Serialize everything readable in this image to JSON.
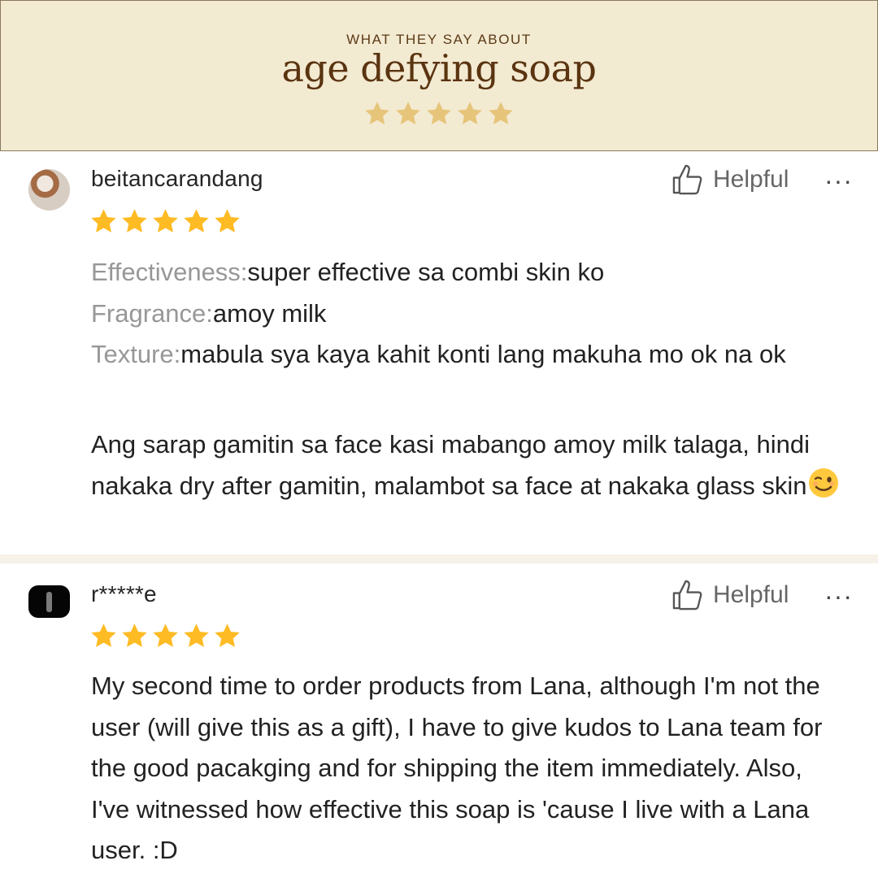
{
  "header": {
    "kicker": "WHAT THEY SAY ABOUT",
    "title": "age defying soap",
    "rating": 5,
    "star_color": "#e6c57a",
    "background": "#f3ead2"
  },
  "reviews": [
    {
      "username": "beitancarandang",
      "avatar_icon": "avatar-photo",
      "helpful_label": "Helpful",
      "more_label": "···",
      "rating": 5,
      "attributes": [
        {
          "label": "Effectiveness:",
          "value": "super effective sa combi skin ko"
        },
        {
          "label": "Fragrance:",
          "value": "amoy milk"
        },
        {
          "label": "Texture:",
          "value": "mabula sya kaya kahit konti lang makuha mo ok na ok"
        }
      ],
      "comment": "Ang sarap gamitin sa face kasi mabango amoy milk talaga, hindi nakaka dry after gamitin, malambot sa face at nakaka glass skin",
      "emoji": "winking-face-emoji"
    },
    {
      "username": "r*****e",
      "avatar_icon": "avatar-photo",
      "helpful_label": "Helpful",
      "more_label": "···",
      "rating": 5,
      "comment": "My second time to order products from Lana, although I'm not the user (will give this as a gift), I have to give kudos to Lana team for the good pacakging and for shipping the item immediately. Also, I've witnessed how effective this soap is 'cause I live with a Lana user. :D"
    }
  ],
  "colors": {
    "review_star": "#ffbb24",
    "separator": "#f6f1e9",
    "attribute_label": "#979797"
  }
}
